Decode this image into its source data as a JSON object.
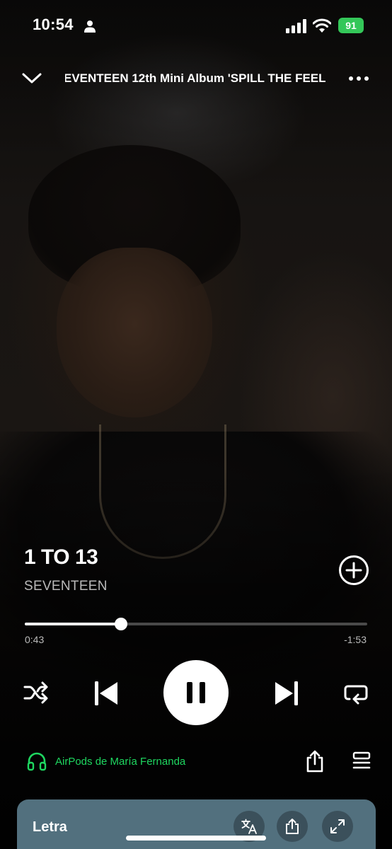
{
  "status_bar": {
    "time": "10:54",
    "battery": "91"
  },
  "header": {
    "context_title": "EVENTEEN 12th Mini Album 'SPILL THE FEEL"
  },
  "track": {
    "title": "1 TO 13",
    "artist": "SEVENTEEN"
  },
  "playback": {
    "elapsed": "0:43",
    "remaining": "-1:53",
    "progress": 0.28,
    "state": "playing"
  },
  "device": {
    "name": "AirPods de María Fernanda"
  },
  "lyrics": {
    "label": "Letra"
  },
  "colors": {
    "accent_green": "#1ed760",
    "lyrics_card": "#52707e",
    "battery": "#34c759"
  },
  "icons": {
    "top_left": "chevron-down-icon",
    "top_right": "more-icon",
    "add": "plus-circle-icon",
    "controls": [
      "shuffle-icon",
      "previous-icon",
      "pause-icon",
      "next-icon",
      "repeat-icon"
    ],
    "device": "headphones-icon",
    "lyrics_actions": [
      "translate-icon",
      "share-icon",
      "expand-icon"
    ]
  }
}
